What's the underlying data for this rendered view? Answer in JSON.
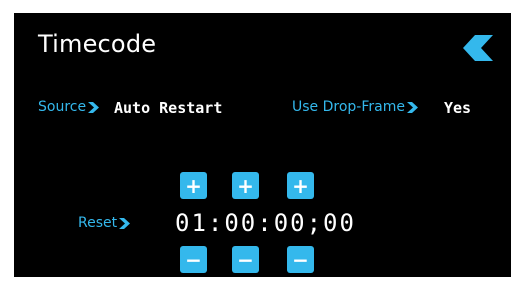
{
  "screen": {
    "title": "Timecode",
    "back_icon": "chevron-left-icon",
    "accent_color": "#34b8ec"
  },
  "source": {
    "label": "Source",
    "value": "Auto Restart"
  },
  "drop_frame": {
    "label": "Use Drop-Frame",
    "value": "Yes"
  },
  "reset": {
    "label": "Reset"
  },
  "timecode": {
    "value": "01:00:00;00",
    "increment_label": "+",
    "decrement_label": "−"
  }
}
